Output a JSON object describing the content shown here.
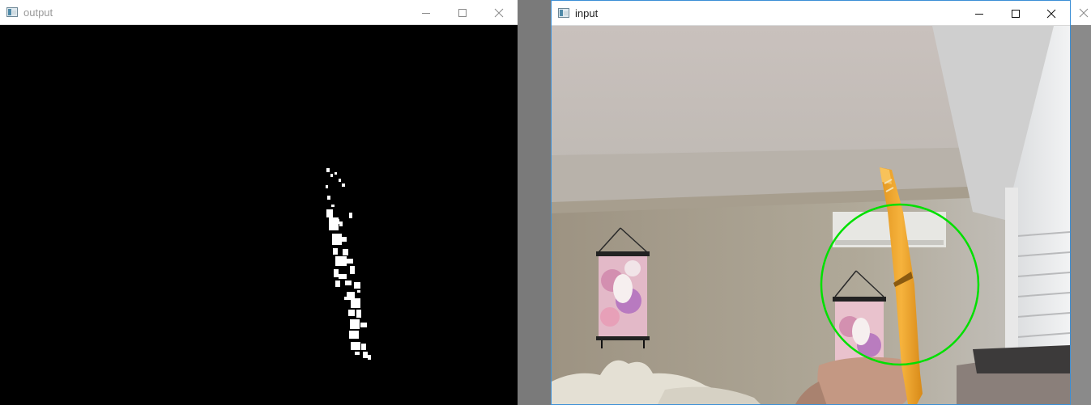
{
  "windows": {
    "output": {
      "title": "output"
    },
    "input": {
      "title": "input"
    }
  },
  "controls": {
    "minimize_icon": "minimize-icon",
    "maximize_icon": "maximize-icon",
    "close_icon": "close-icon"
  },
  "colors": {
    "tracking_circle": "#00e000",
    "mask_foreground": "#ffffff",
    "mask_background": "#000000",
    "tracked_object": "#f0a830",
    "active_window_border": "#3b8fd6"
  }
}
